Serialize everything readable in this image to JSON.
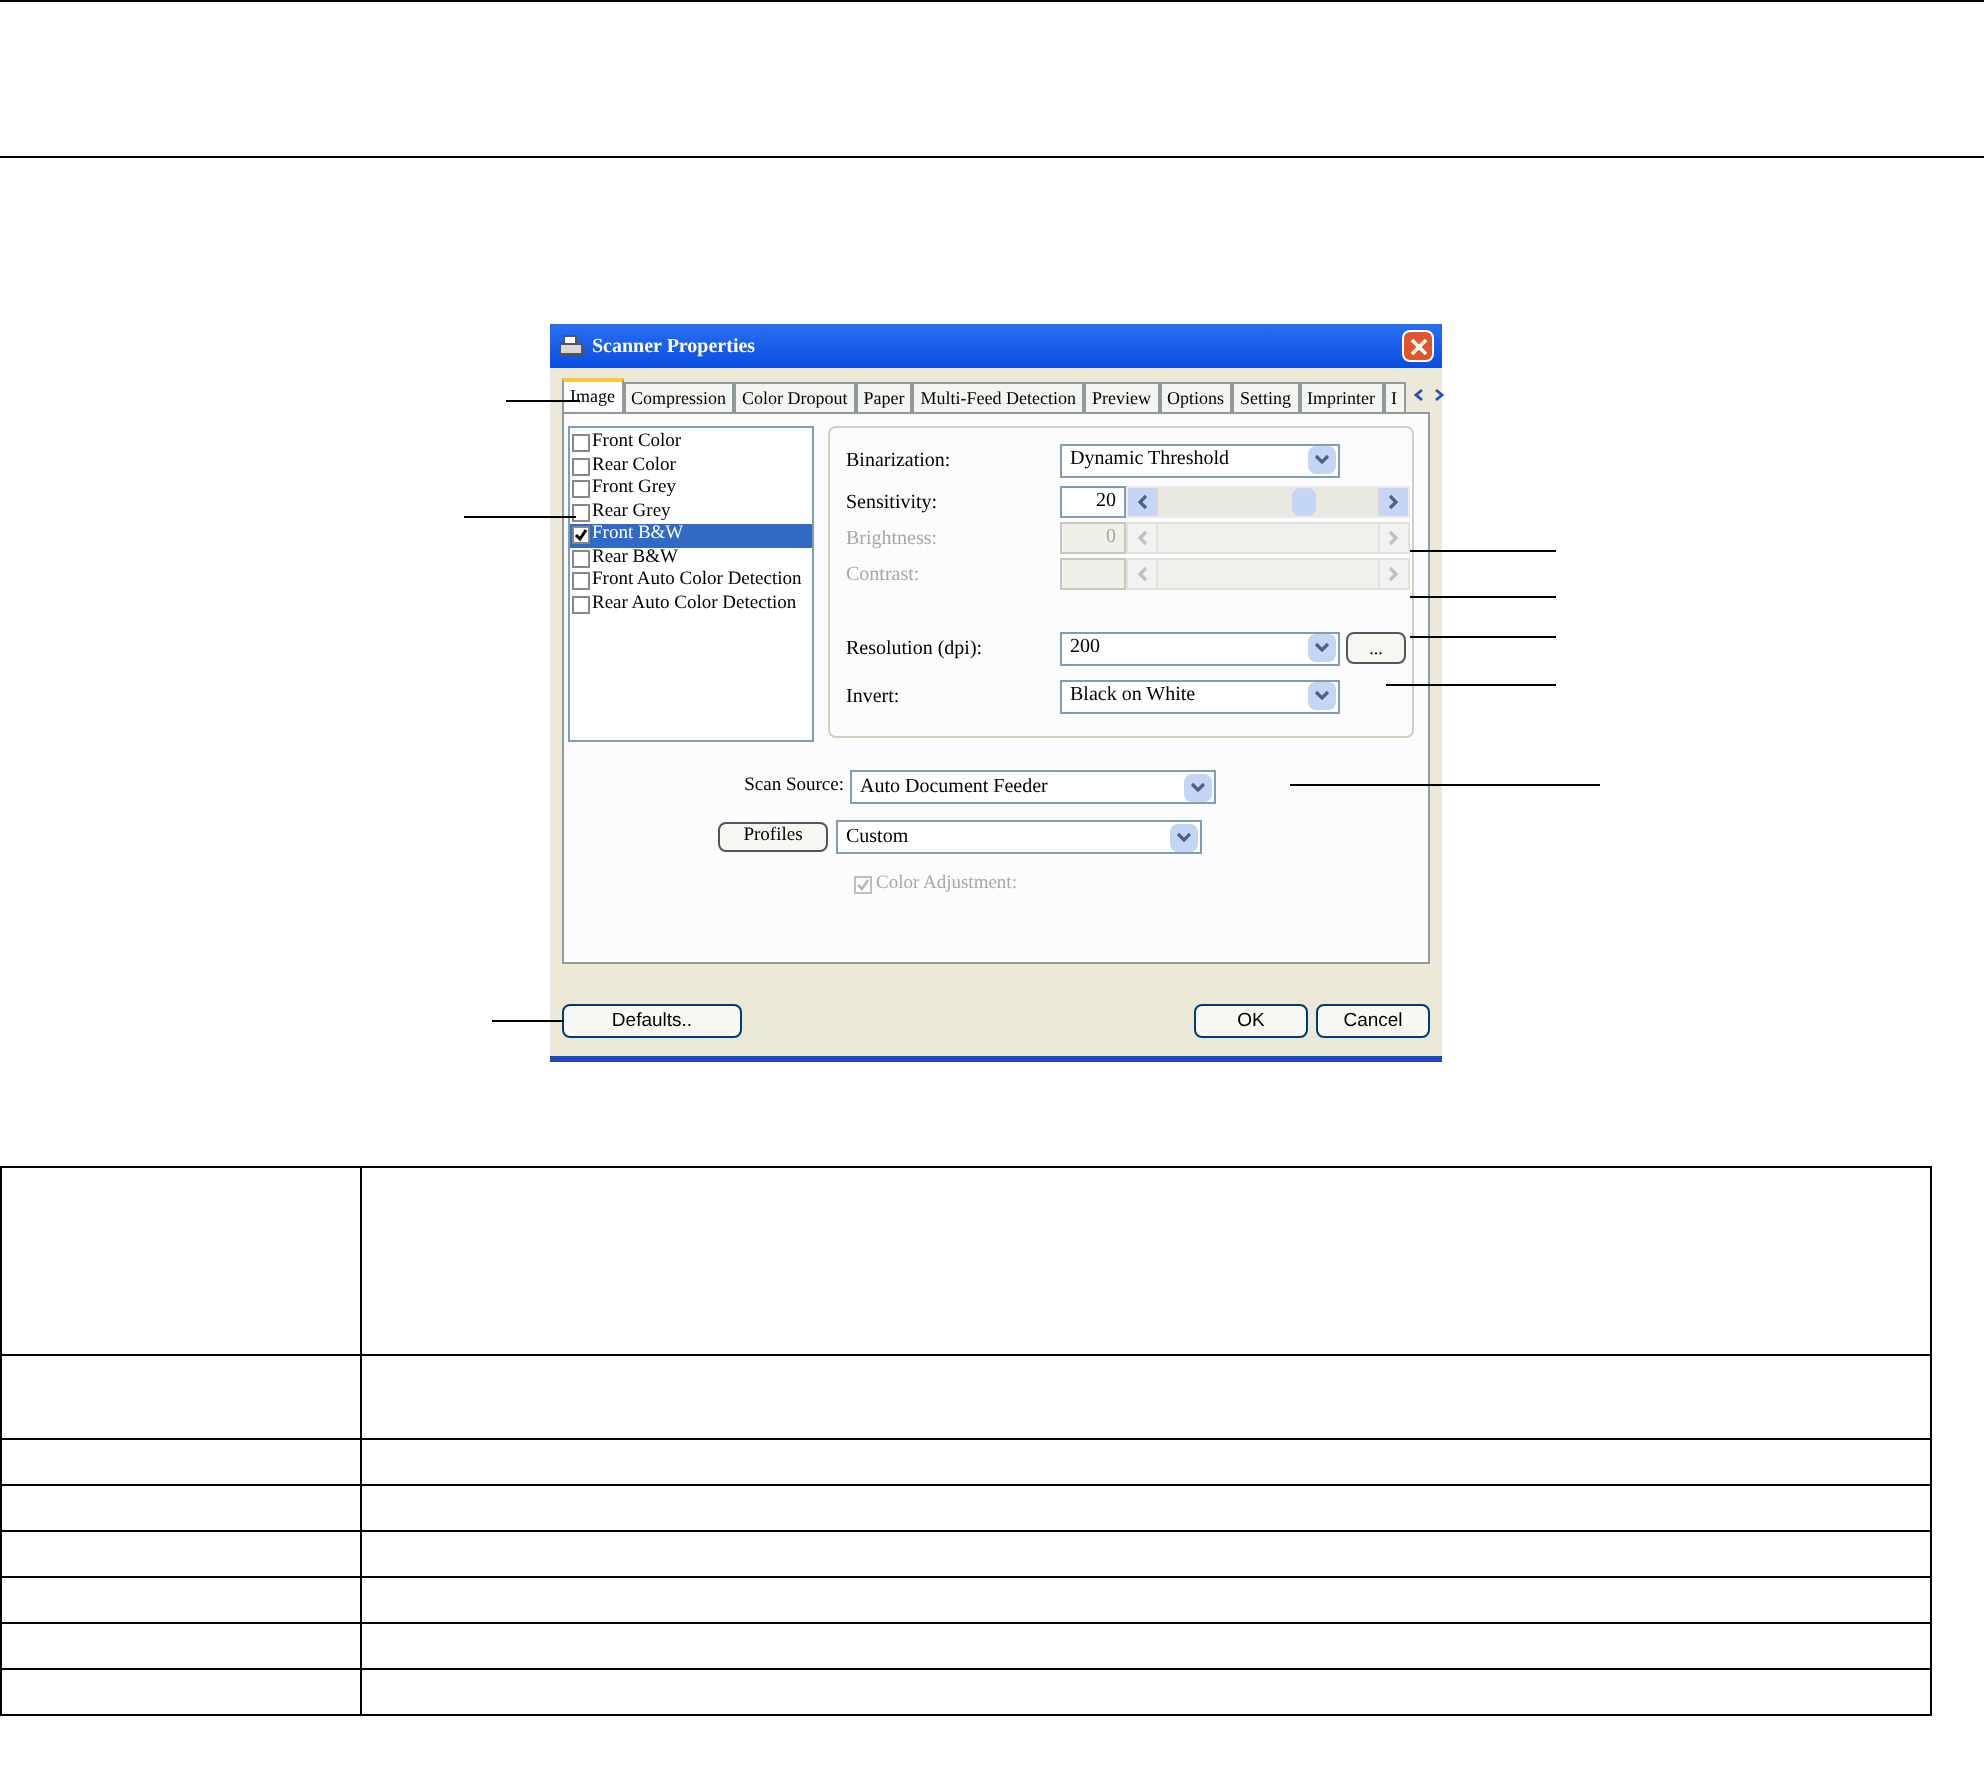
{
  "dialog": {
    "title": "Scanner Properties",
    "tabs": [
      {
        "label": "Image",
        "selected": true
      },
      {
        "label": "Compression",
        "selected": false
      },
      {
        "label": "Color Dropout",
        "selected": false
      },
      {
        "label": "Paper",
        "selected": false
      },
      {
        "label": "Multi-Feed Detection",
        "selected": false
      },
      {
        "label": "Preview",
        "selected": false
      },
      {
        "label": "Options",
        "selected": false
      },
      {
        "label": "Setting",
        "selected": false
      },
      {
        "label": "Imprinter",
        "selected": false
      },
      {
        "label": "I",
        "selected": false
      }
    ],
    "image_list": [
      {
        "label": "Front Color",
        "checked": false,
        "selected": false
      },
      {
        "label": "Rear Color",
        "checked": false,
        "selected": false
      },
      {
        "label": "Front Grey",
        "checked": false,
        "selected": false
      },
      {
        "label": "Rear Grey",
        "checked": false,
        "selected": false
      },
      {
        "label": "Front B&W",
        "checked": true,
        "selected": true
      },
      {
        "label": "Rear B&W",
        "checked": false,
        "selected": false
      },
      {
        "label": "Front Auto Color Detection",
        "checked": false,
        "selected": false
      },
      {
        "label": "Rear Auto Color Detection",
        "checked": false,
        "selected": false
      }
    ],
    "settings": [
      {
        "kind": "dropdown",
        "label": "Binarization:",
        "value": "Dynamic Threshold"
      },
      {
        "kind": "slider",
        "label": "Sensitivity:",
        "value": "20",
        "level": 0.66,
        "disabled": false
      },
      {
        "kind": "slider",
        "label": "Brightness:",
        "value": "0",
        "disabled": true
      },
      {
        "kind": "slider",
        "label": "Contrast:",
        "disabled": true
      },
      {
        "kind": "gap"
      },
      {
        "kind": "dropdown",
        "label": "Resolution (dpi):",
        "value": "200",
        "button": "..."
      },
      {
        "kind": "dropdown",
        "label": "Invert:",
        "value": "Black on White"
      }
    ],
    "scan_source": {
      "label": "Scan Source:",
      "value": "Auto Document Feeder"
    },
    "profiles": {
      "button": "Profiles",
      "value": "Custom"
    },
    "color_adjustment": {
      "label": "Color Adjustment:",
      "checked": true,
      "disabled": true
    },
    "buttons": [
      {
        "label": "Defaults..",
        "kind": "left"
      },
      {
        "label": "OK",
        "kind": "right"
      },
      {
        "label": "Cancel",
        "kind": "right"
      }
    ]
  }
}
